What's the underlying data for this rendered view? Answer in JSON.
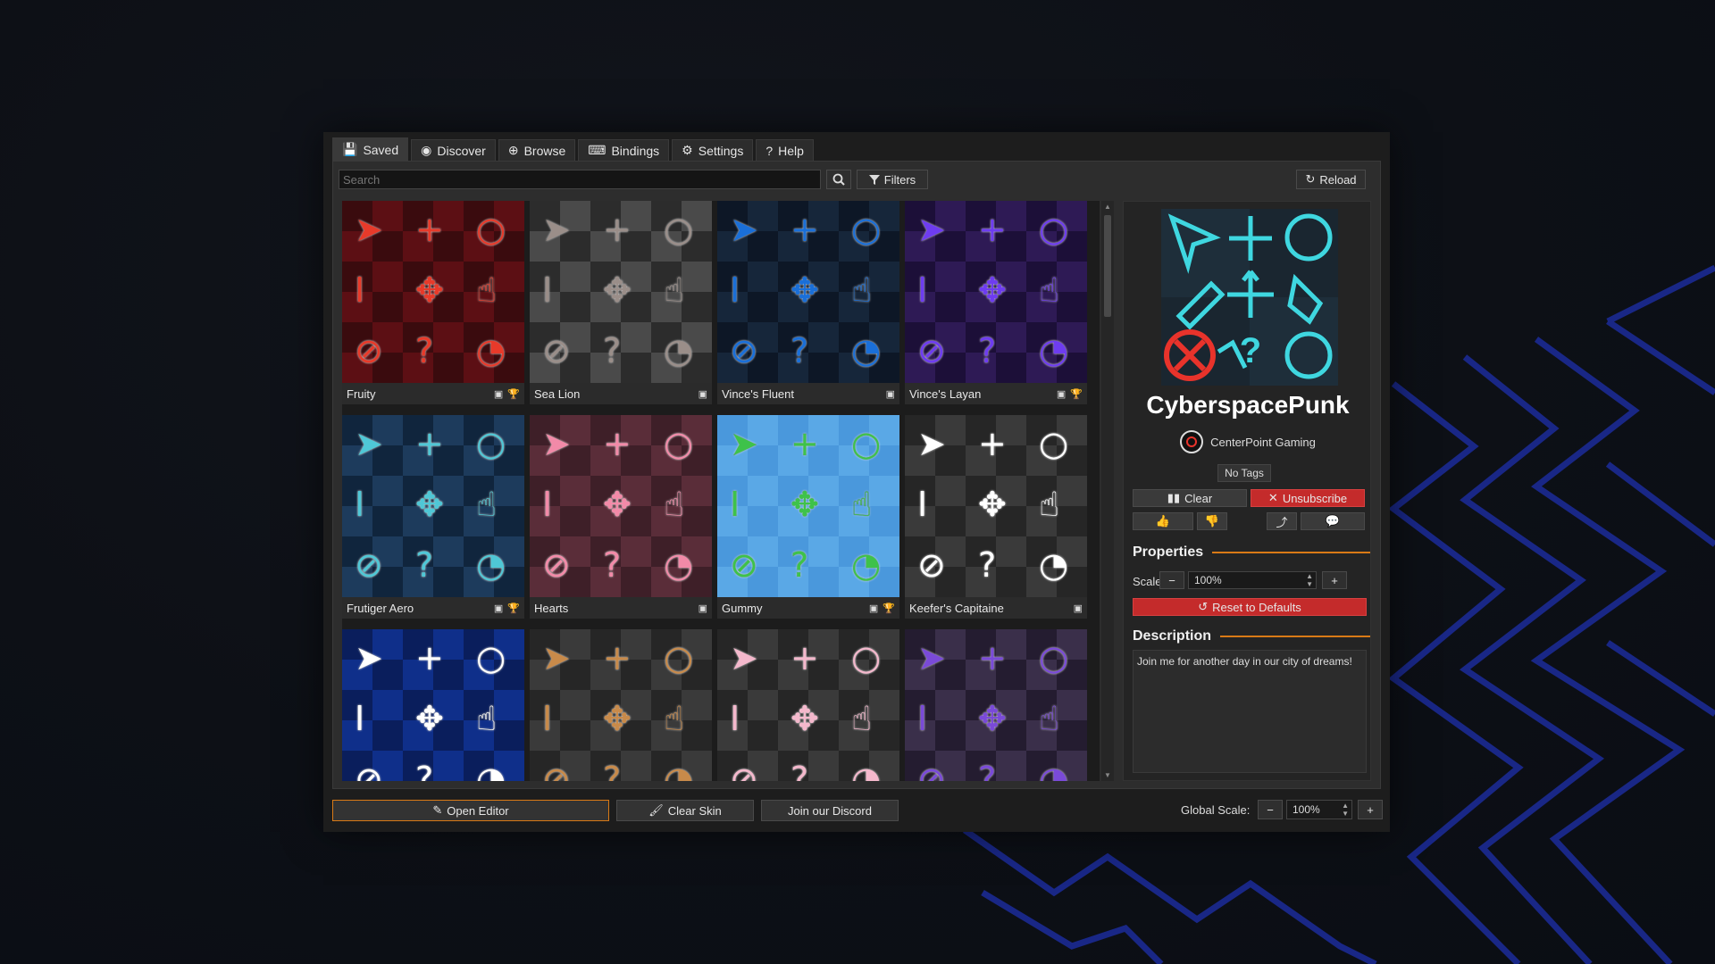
{
  "tabs": [
    {
      "label": "Saved",
      "icon": "save-icon"
    },
    {
      "label": "Discover",
      "icon": "compass-icon"
    },
    {
      "label": "Browse",
      "icon": "globe-icon"
    },
    {
      "label": "Bindings",
      "icon": "keyboard-icon"
    },
    {
      "label": "Settings",
      "icon": "gear-icon"
    },
    {
      "label": "Help",
      "icon": "help-icon"
    }
  ],
  "toolbar": {
    "search_placeholder": "Search",
    "filters_label": "Filters",
    "reload_label": "Reload"
  },
  "skins": [
    {
      "name": "Fruity",
      "icons": [
        "save",
        "trophy"
      ],
      "bg1": "#5c0f14",
      "bg2": "#3a0b0e",
      "accent": "#e83a2a"
    },
    {
      "name": "Sea Lion",
      "icons": [
        "save"
      ],
      "bg1": "#4a4a4a",
      "bg2": "#2c2c2c",
      "accent": "#9a8e89"
    },
    {
      "name": "Vince's Fluent",
      "icons": [
        "save"
      ],
      "bg1": "#16263a",
      "bg2": "#0d1726",
      "accent": "#1a6fd8"
    },
    {
      "name": "Vince's Layan",
      "icons": [
        "save",
        "trophy"
      ],
      "bg1": "#2e1a55",
      "bg2": "#1c0f38",
      "accent": "#6e3cf0"
    },
    {
      "name": "Frutiger Aero",
      "icons": [
        "save",
        "trophy"
      ],
      "bg1": "#1d3b5c",
      "bg2": "#10253d",
      "accent": "#4fc7d6"
    },
    {
      "name": "Hearts",
      "icons": [
        "save"
      ],
      "bg1": "#5a2d39",
      "bg2": "#3e1f28",
      "accent": "#f28aa8"
    },
    {
      "name": "Gummy",
      "icons": [
        "save",
        "trophy"
      ],
      "bg1": "#5aa8e6",
      "bg2": "#4a98dc",
      "accent": "#3ec24a"
    },
    {
      "name": "Keefer's Capitaine",
      "icons": [
        "save"
      ],
      "bg1": "#3a3a3a",
      "bg2": "#262626",
      "accent": "#ffffff"
    },
    {
      "name": "",
      "icons": [],
      "bg1": "#0f2f8a",
      "bg2": "#0a1e5c",
      "accent": "#ffffff"
    },
    {
      "name": "",
      "icons": [],
      "bg1": "#3a3a3a",
      "bg2": "#262626",
      "accent": "#c88a4a"
    },
    {
      "name": "",
      "icons": [],
      "bg1": "#3a3a3a",
      "bg2": "#262626",
      "accent": "#f4b8cc"
    },
    {
      "name": "",
      "icons": [],
      "bg1": "#3a2f4a",
      "bg2": "#241c30",
      "accent": "#7a4ad8"
    }
  ],
  "selected": {
    "title": "CyberspacePunk",
    "author": "CenterPoint Gaming",
    "tags": "No Tags",
    "clear_label": "Clear",
    "unsubscribe_label": "Unsubscribe",
    "properties_heading": "Properties",
    "scale_label": "Scale",
    "scale_value": "100%",
    "reset_label": "Reset to Defaults",
    "description_heading": "Description",
    "description": "Join me for another day in our city of dreams!"
  },
  "bottom": {
    "open_editor": "Open Editor",
    "clear_skin": "Clear Skin",
    "discord": "Join our Discord",
    "global_scale_label": "Global Scale:",
    "global_scale_value": "100%"
  },
  "colors": {
    "accent_orange": "#d97a16",
    "danger_red": "#c42b2b",
    "cyan": "#3fd7e0"
  }
}
